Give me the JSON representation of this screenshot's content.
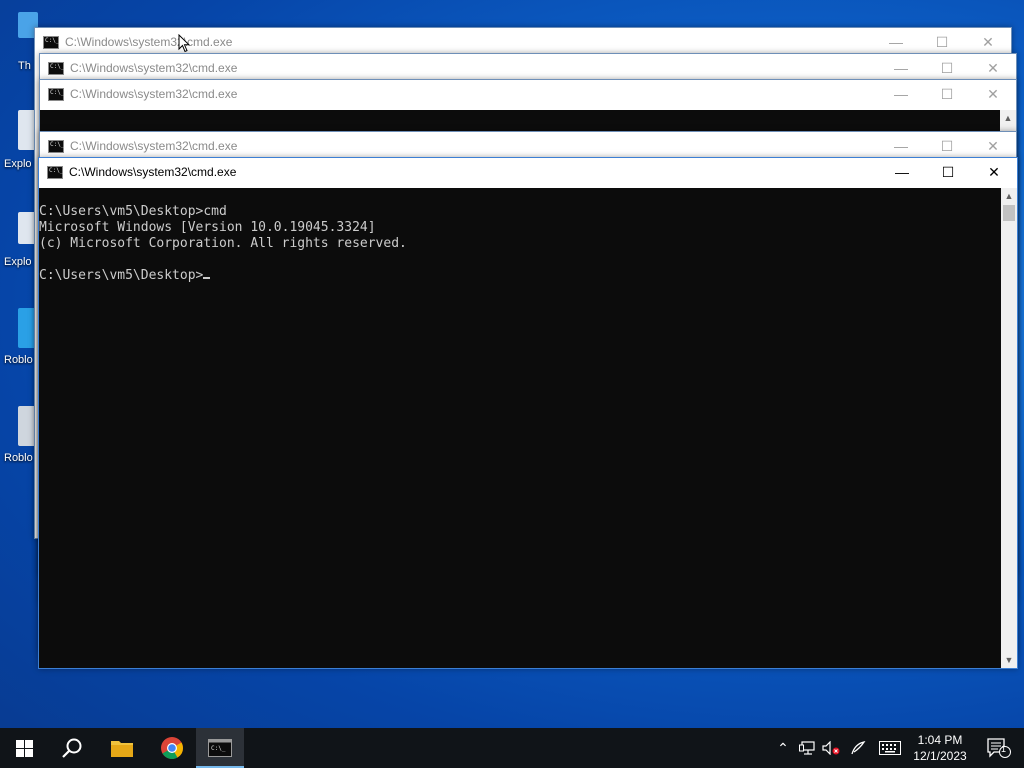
{
  "desktop": {
    "icons": [
      {
        "label": "Th"
      },
      {
        "label": "Explo"
      },
      {
        "label": "Explo"
      },
      {
        "label": "Roblo"
      },
      {
        "label": "Roblo"
      }
    ]
  },
  "windows": [
    {
      "title": "C:\\Windows\\system32\\cmd.exe"
    },
    {
      "title": "C:\\Windows\\system32\\cmd.exe"
    },
    {
      "title": "C:\\Windows\\system32\\cmd.exe"
    },
    {
      "title": "C:\\Windows\\system32\\cmd.exe"
    },
    {
      "title": "C:\\Windows\\system32\\cmd.exe"
    }
  ],
  "controls": {
    "minimize": "—",
    "maximize": "☐",
    "close": "✕"
  },
  "terminal": {
    "lines": [
      "C:\\Users\\vm5\\Desktop>cmd",
      "Microsoft Windows [Version 10.0.19045.3324]",
      "(c) Microsoft Corporation. All rights reserved.",
      "",
      "C:\\Users\\vm5\\Desktop>"
    ]
  },
  "taskbar": {
    "clock_time": "1:04 PM",
    "clock_date": "12/1/2023",
    "notification_count": "1",
    "accent": "#76b9ed"
  }
}
